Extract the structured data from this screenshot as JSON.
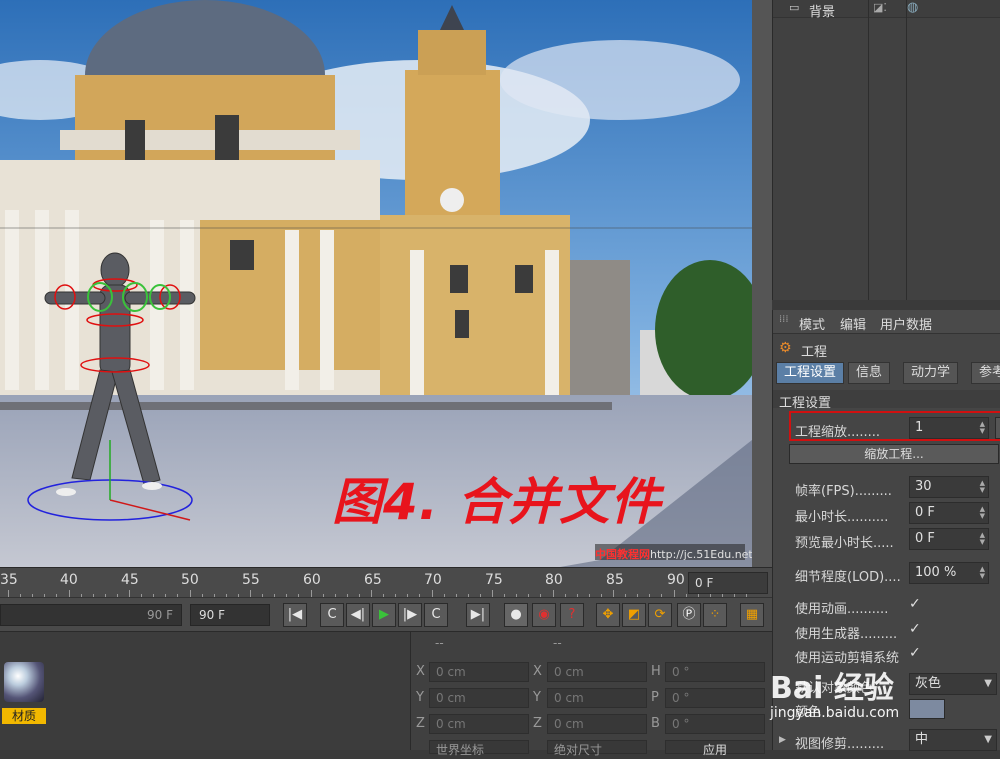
{
  "viewport": {
    "overlay_title": "图4. 合并文件",
    "watermark_prefix": "中国教程网",
    "watermark_url": "http://jc.51Edu.net/00..."
  },
  "timeline": {
    "ticks": [
      "35",
      "40",
      "45",
      "50",
      "55",
      "60",
      "65",
      "70",
      "75",
      "80",
      "85",
      "90"
    ],
    "current_frame": "0 F"
  },
  "transport": {
    "end_frame_left": "90 F",
    "end_frame_right": "90 F",
    "buttons": [
      "|◀",
      "C",
      "◀|",
      "▶",
      "|▶",
      "C",
      "▶|"
    ]
  },
  "materials": {
    "item_label": "材质"
  },
  "coordinates": {
    "header_left": "--",
    "header_right": "--",
    "rows": [
      {
        "a": "X",
        "av": "0 cm",
        "b": "X",
        "bv": "0 cm",
        "c": "H",
        "cv": "0 °"
      },
      {
        "a": "Y",
        "av": "0 cm",
        "b": "Y",
        "bv": "0 cm",
        "c": "P",
        "cv": "0 °"
      },
      {
        "a": "Z",
        "av": "0 cm",
        "b": "Z",
        "bv": "0 cm",
        "c": "B",
        "cv": "0 °"
      }
    ],
    "btn_world": "世界坐标",
    "btn_abs": "绝对尺寸",
    "btn_apply": "应用"
  },
  "objects": {
    "item_name": "背景"
  },
  "attributes": {
    "menu": [
      "模式",
      "编辑",
      "用户数据"
    ],
    "title": "工程",
    "tabs": [
      "工程设置",
      "信息",
      "动力学",
      "参考"
    ],
    "section": "工程设置",
    "scale_label": "工程缩放........",
    "scale_value": "1",
    "scale_button": "缩放工程...",
    "fps_label": "帧率(FPS).........",
    "fps_value": "30",
    "min_time_label": "最小时长..........",
    "min_time_value": "0 F",
    "preview_min_label": "预览最小时长.....",
    "preview_min_value": "0 F",
    "lod_label": "细节程度(LOD)....",
    "lod_value": "100 %",
    "use_anim_label": "使用动画..........",
    "use_gen_label": "使用生成器.........",
    "use_motion_label": "使用运动剪辑系统",
    "default_color_label": "默认对象颜色",
    "default_color_value": "灰色",
    "color_label": "颜色",
    "view_trim_label": "视图修剪.........",
    "view_trim_value": "中"
  },
  "watermark": {
    "logo": "Bai 经验",
    "url": "jingyan.baidu.com"
  }
}
